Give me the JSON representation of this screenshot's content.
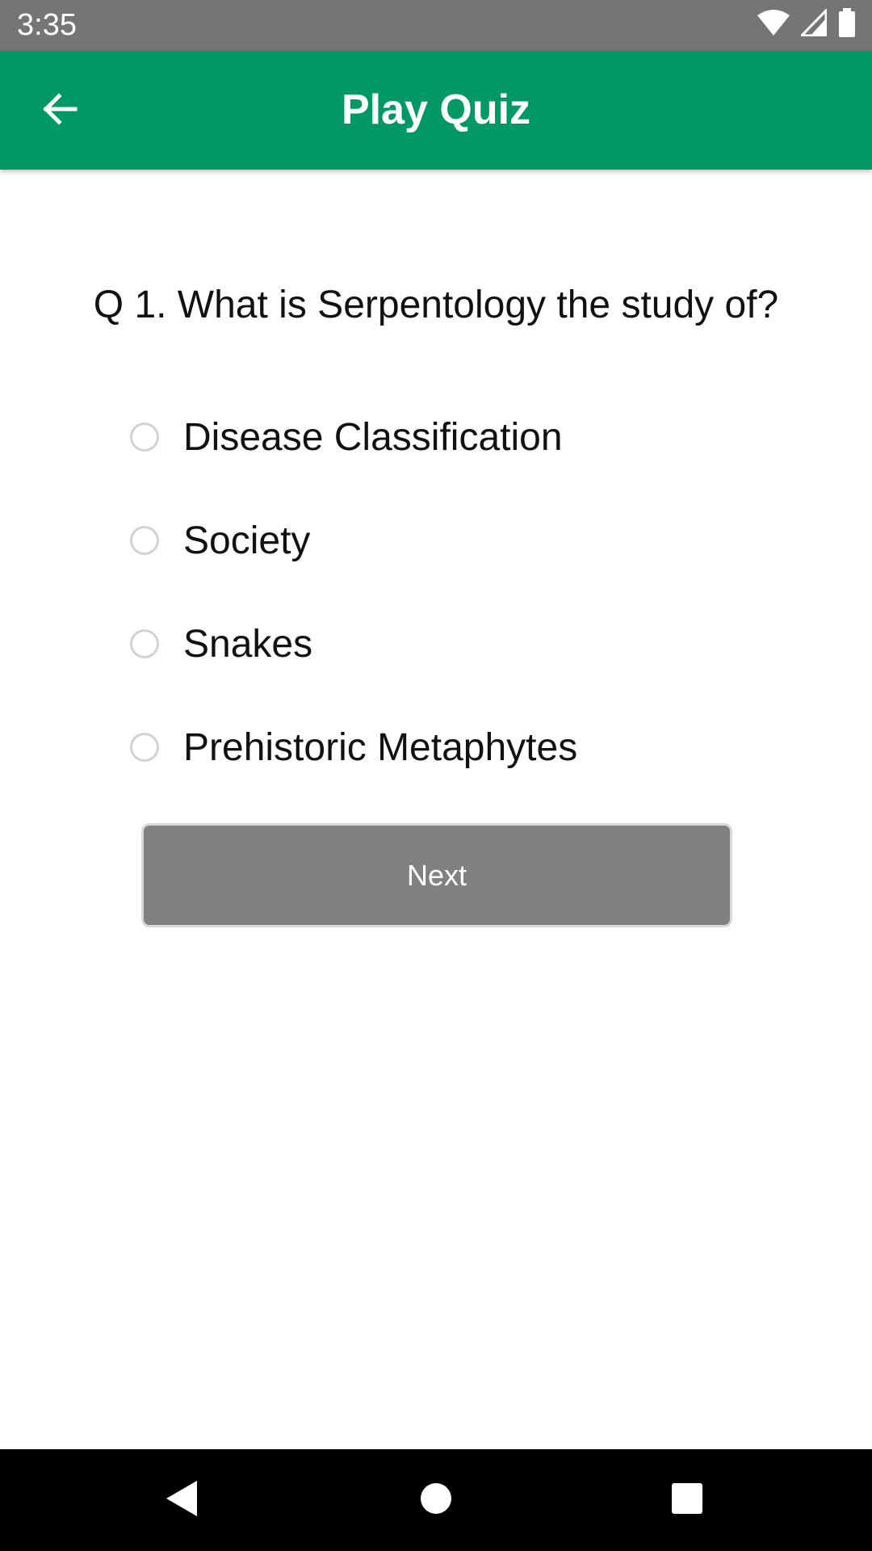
{
  "status_bar": {
    "time": "3:35",
    "icons": [
      "wifi-icon",
      "cell-signal-icon",
      "battery-icon"
    ]
  },
  "app_bar": {
    "title": "Play Quiz",
    "back_icon": "arrow-back-icon",
    "color": "#009966"
  },
  "quiz": {
    "question": "Q 1. What is Serpentology the study of?",
    "options": [
      {
        "label": "Disease Classification"
      },
      {
        "label": "Society"
      },
      {
        "label": "Snakes"
      },
      {
        "label": "Prehistoric Metaphytes"
      }
    ],
    "next_label": "Next"
  },
  "nav_bar": {
    "icons": [
      "back-triangle-icon",
      "home-circle-icon",
      "recents-square-icon"
    ]
  }
}
